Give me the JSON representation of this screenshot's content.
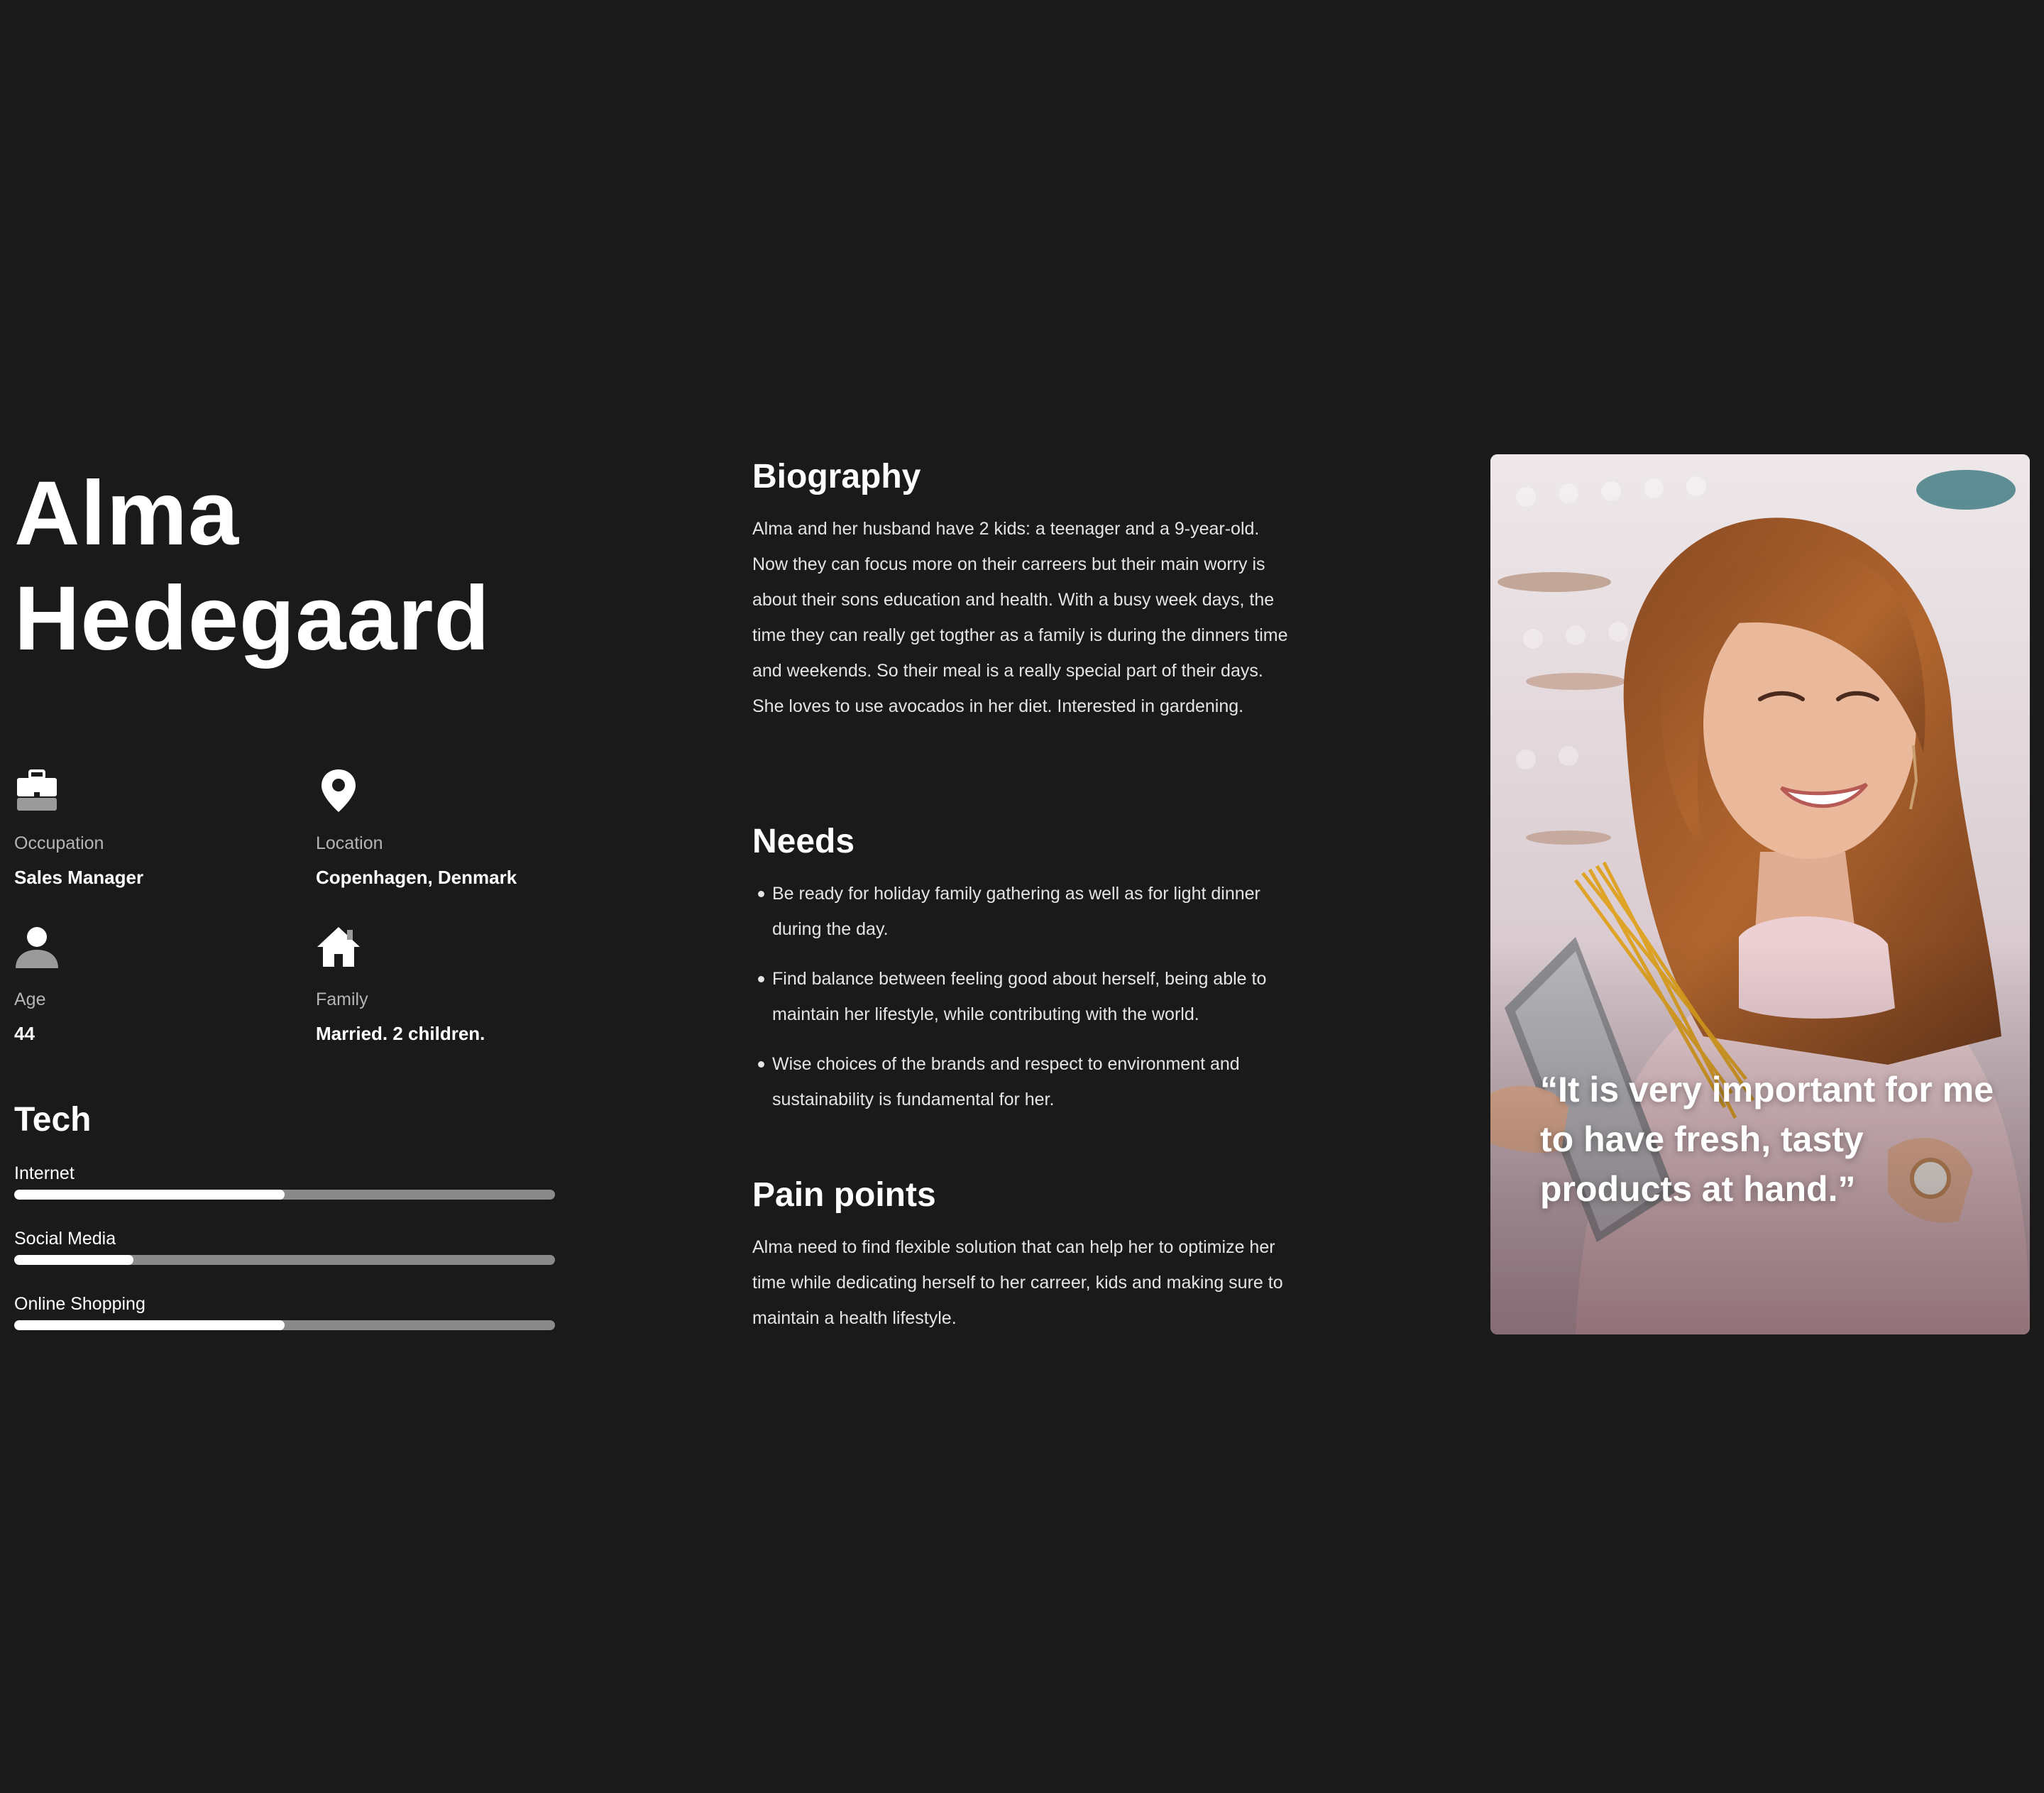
{
  "persona": {
    "first_name": "Alma",
    "last_name": "Hedegaard"
  },
  "info": {
    "occupation": {
      "label": "Occupation",
      "value": "Sales Manager",
      "icon": "briefcase-icon"
    },
    "location": {
      "label": "Location",
      "value": "Copenhagen, Denmark",
      "icon": "map-pin-icon"
    },
    "age": {
      "label": "Age",
      "value": "44",
      "icon": "person-icon"
    },
    "family": {
      "label": "Family",
      "value": "Married. 2 children.",
      "icon": "home-icon"
    }
  },
  "tech": {
    "title": "Tech",
    "items": [
      {
        "label": "Internet",
        "level": 0.5
      },
      {
        "label": "Social Media",
        "level": 0.22
      },
      {
        "label": "Online Shopping",
        "level": 0.5
      }
    ]
  },
  "biography": {
    "title": "Biography",
    "text": "Alma and her husband have 2 kids: a teenager and a 9-year-old. Now they can focus more on their carreers but their main worry is about their sons education and health. With a busy week days, the time they can really get togther as a family is during the dinners time and weekends. So their meal is a really special part of their days. She loves to use avocados in her diet. Interested in gardening."
  },
  "needs": {
    "title": "Needs",
    "items": [
      "Be ready for holiday family gathering as well as for light dinner during the day.",
      "Find balance between feeling good about herself, being able to maintain her lifestyle, while contributing with the world.",
      "Wise choices of the brands and respect to environment and sustainability is fundamental for her."
    ]
  },
  "pain_points": {
    "title": "Pain points",
    "text": "Alma need to find flexible solution that can help her to optimize her time while dedicating herself to her carreer, kids and making sure to maintain a health lifestyle."
  },
  "quote": {
    "text": "“It is very important for me to have fresh, tasty products at hand.”"
  },
  "colors": {
    "background": "#1a1a1a",
    "text": "#ffffff",
    "muted": "#b5b5b5",
    "bar_track": "#8a8a8a",
    "bar_fill": "#ffffff"
  }
}
